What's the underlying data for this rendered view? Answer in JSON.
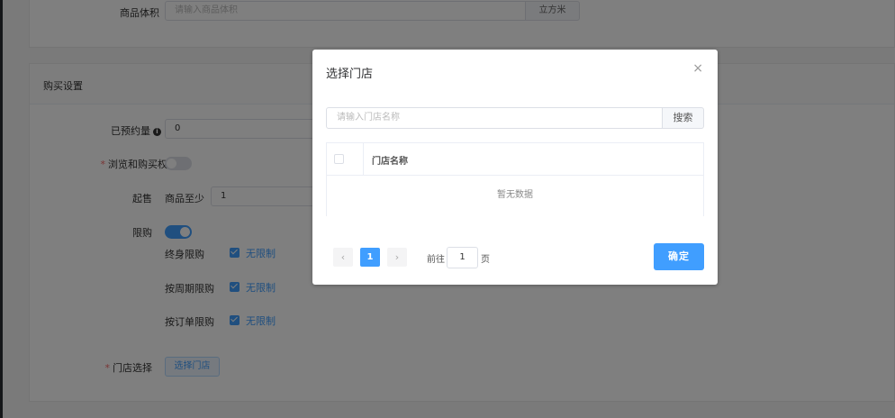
{
  "top_section": {
    "volume_label": "商品体积",
    "volume_placeholder": "请输入商品体积",
    "volume_unit": "立方米"
  },
  "purchase": {
    "section_title": "购买设置",
    "presale_label": "已预约量",
    "presale_value": "0",
    "browse_label": "浏览和购买权限",
    "browse_enabled": false,
    "min_label": "起售",
    "min_prefix": "商品至少",
    "min_value": "1",
    "limit_label": "限购",
    "limit_enabled": true,
    "limits": [
      {
        "label": "终身限购",
        "checked": true,
        "value": "无限制"
      },
      {
        "label": "按周期限购",
        "checked": true,
        "value": "无限制"
      },
      {
        "label": "按订单限购",
        "checked": true,
        "value": "无限制"
      }
    ],
    "store_label": "门店选择",
    "store_button": "选择门店"
  },
  "dialog": {
    "title": "选择门店",
    "close": "×",
    "search_placeholder": "请输入门店名称",
    "search_button": "搜索",
    "column_name": "门店名称",
    "empty_text": "暂无数据",
    "pager": {
      "prev": "‹",
      "current": "1",
      "next": "›",
      "goto_prefix": "前往",
      "goto_value": "1",
      "goto_suffix": "页"
    },
    "confirm_button": "确定"
  },
  "colors": {
    "primary": "#409eff",
    "required": "#f56c6c"
  }
}
